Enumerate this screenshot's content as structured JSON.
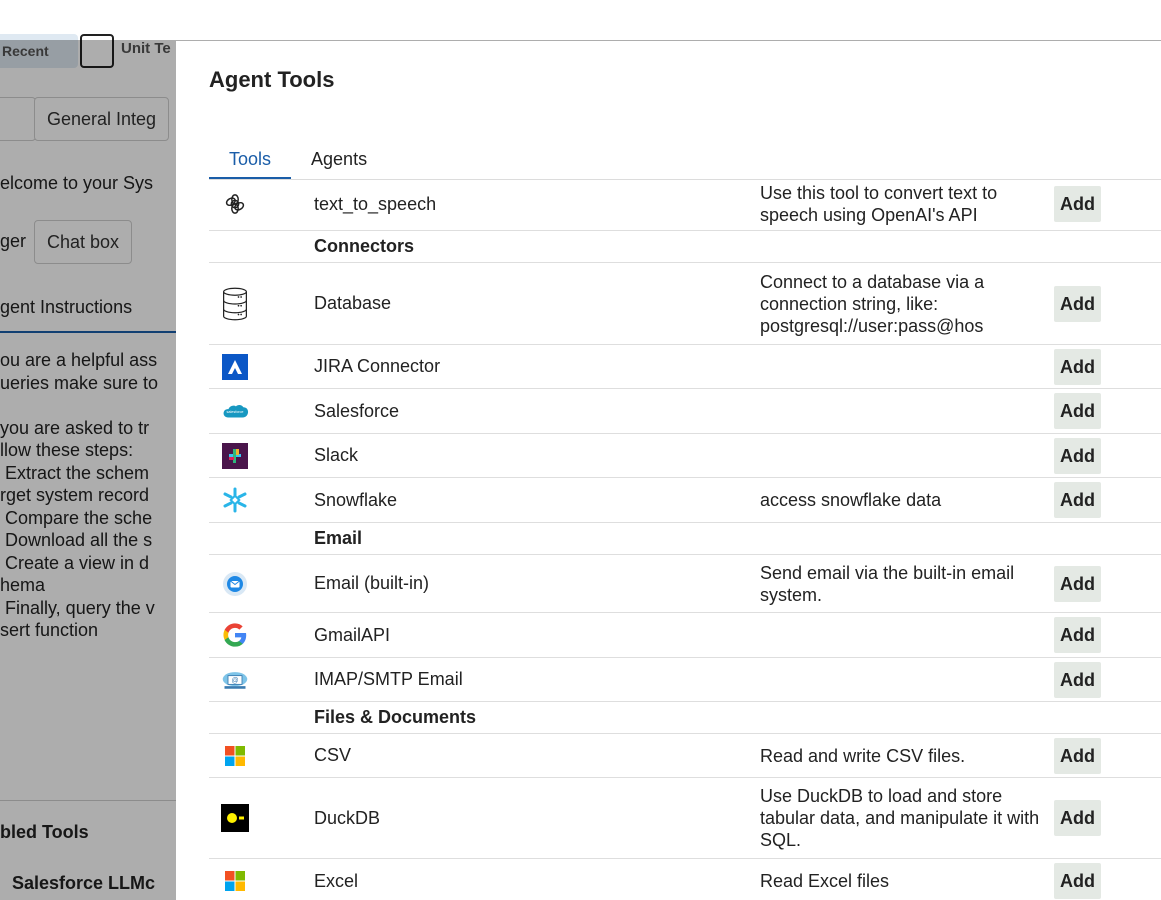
{
  "background": {
    "recent_label": "Recent",
    "unit_label": "Unit Te",
    "general_integration": "General Integ",
    "welcome_text": "elcome to your Sys",
    "ger_text": "ger",
    "chat_box": "Chat box",
    "agent_instructions_tab": "gent Instructions",
    "instructions_lines": [
      "ou are a helpful ass",
      "ueries make sure to",
      "",
      "you are asked to tr",
      "llow these steps:",
      " Extract the schem",
      "rget system record",
      " Compare the sche",
      " Download all the s",
      " Create a view in d",
      "hema",
      " Finally, query the v",
      "sert function"
    ],
    "enabled_tools_label": "bled Tools",
    "salesforce_tool": "Salesforce LLMc"
  },
  "modal": {
    "title": "Agent Tools",
    "tabs": [
      {
        "label": "Tools",
        "active": true
      },
      {
        "label": "Agents",
        "active": false
      }
    ],
    "add_label": "Add",
    "rows": [
      {
        "kind": "tool",
        "icon": "openai-icon",
        "name": "text_to_speech",
        "desc": "Use this tool to convert text to speech using OpenAI's API"
      },
      {
        "kind": "section",
        "name": "Connectors"
      },
      {
        "kind": "tool",
        "icon": "database-icon",
        "name": "Database",
        "desc": "Connect to a database via a connection string, like: postgresql://user:pass@hos"
      },
      {
        "kind": "tool",
        "icon": "jira-icon",
        "name": "JIRA Connector",
        "desc": ""
      },
      {
        "kind": "tool",
        "icon": "salesforce-icon",
        "name": "Salesforce",
        "desc": ""
      },
      {
        "kind": "tool",
        "icon": "slack-icon",
        "name": "Slack",
        "desc": ""
      },
      {
        "kind": "tool",
        "icon": "snowflake-icon",
        "name": "Snowflake",
        "desc": "access snowflake data"
      },
      {
        "kind": "section",
        "name": "Email"
      },
      {
        "kind": "tool",
        "icon": "email-icon",
        "name": "Email (built-in)",
        "desc": "Send email via the built-in email system."
      },
      {
        "kind": "tool",
        "icon": "google-icon",
        "name": "GmailAPI",
        "desc": ""
      },
      {
        "kind": "tool",
        "icon": "imap-email-icon",
        "name": "IMAP/SMTP Email",
        "desc": ""
      },
      {
        "kind": "section",
        "name": "Files & Documents"
      },
      {
        "kind": "tool",
        "icon": "microsoft-icon",
        "name": "CSV",
        "desc": "Read and write CSV files."
      },
      {
        "kind": "tool",
        "icon": "duckdb-icon",
        "name": "DuckDB",
        "desc": "Use DuckDB to load and store tabular data, and manipulate it with SQL."
      },
      {
        "kind": "tool",
        "icon": "microsoft-icon",
        "name": "Excel",
        "desc": "Read Excel files"
      }
    ],
    "colors": {
      "accent": "#1a5da8",
      "add_bg": "#e4e9e4"
    }
  }
}
